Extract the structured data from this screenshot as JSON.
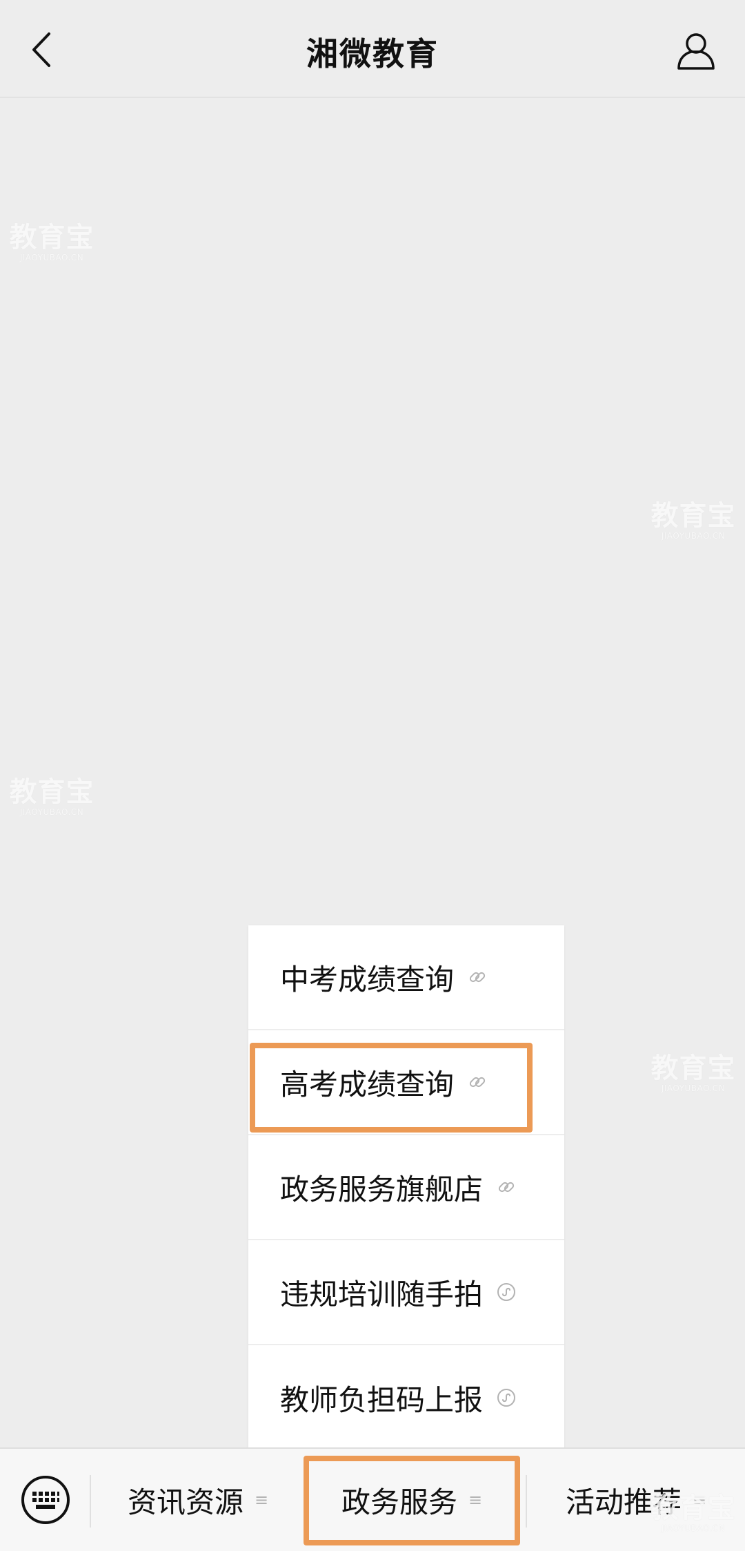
{
  "navbar": {
    "title": "湘微教育",
    "back_icon": "chevron-left-icon",
    "profile_icon": "user-profile-icon"
  },
  "watermark": {
    "main": "教育宝",
    "sub": "JIAOYUBAO.CN"
  },
  "submenu": {
    "items": [
      {
        "label": "中考成绩查询",
        "icon": "link-icon"
      },
      {
        "label": "高考成绩查询",
        "icon": "link-icon"
      },
      {
        "label": "政务服务旗舰店",
        "icon": "link-icon"
      },
      {
        "label": "违规培训随手拍",
        "icon": "mini-program-icon"
      },
      {
        "label": "教师负担码上报",
        "icon": "mini-program-icon"
      }
    ],
    "highlighted_index": 1
  },
  "bottombar": {
    "keyboard_icon": "keyboard-icon",
    "tabs": [
      {
        "label": "资讯资源",
        "icon": "menu-lines-icon"
      },
      {
        "label": "政务服务",
        "icon": "menu-lines-icon"
      },
      {
        "label": "活动推荐",
        "icon": "menu-lines-icon"
      }
    ],
    "active_index": 1
  },
  "colors": {
    "background": "#ededed",
    "highlight": "#ec9a55",
    "menu_bg": "#ffffff",
    "icon_gray": "#b3b3b3"
  }
}
